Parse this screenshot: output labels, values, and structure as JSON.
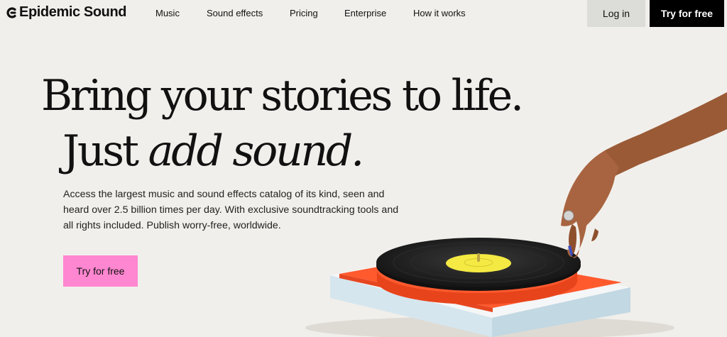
{
  "brand": {
    "name": "Epidemic Sound"
  },
  "nav": {
    "links": [
      "Music",
      "Sound effects",
      "Pricing",
      "Enterprise",
      "How it works"
    ],
    "login_label": "Log in",
    "try_label": "Try for free"
  },
  "hero": {
    "line1": "Bring your stories to life.",
    "line2_plain": "Just ",
    "line2_italic": "add sound.",
    "description": "Access the largest music and sound effects catalog of its kind, seen and heard over 2.5 billion times per day. With exclusive soundtracking tools and all rights included. Publish worry-free, worldwide.",
    "cta_label": "Try for free"
  },
  "colors": {
    "background": "#f1efeb",
    "cta_pink": "#ff86d0",
    "nav_cta": "#000000",
    "login_bg": "#dcdcd8",
    "turntable_orange": "#ff5a2e",
    "record_label_yellow": "#f4ea43"
  }
}
